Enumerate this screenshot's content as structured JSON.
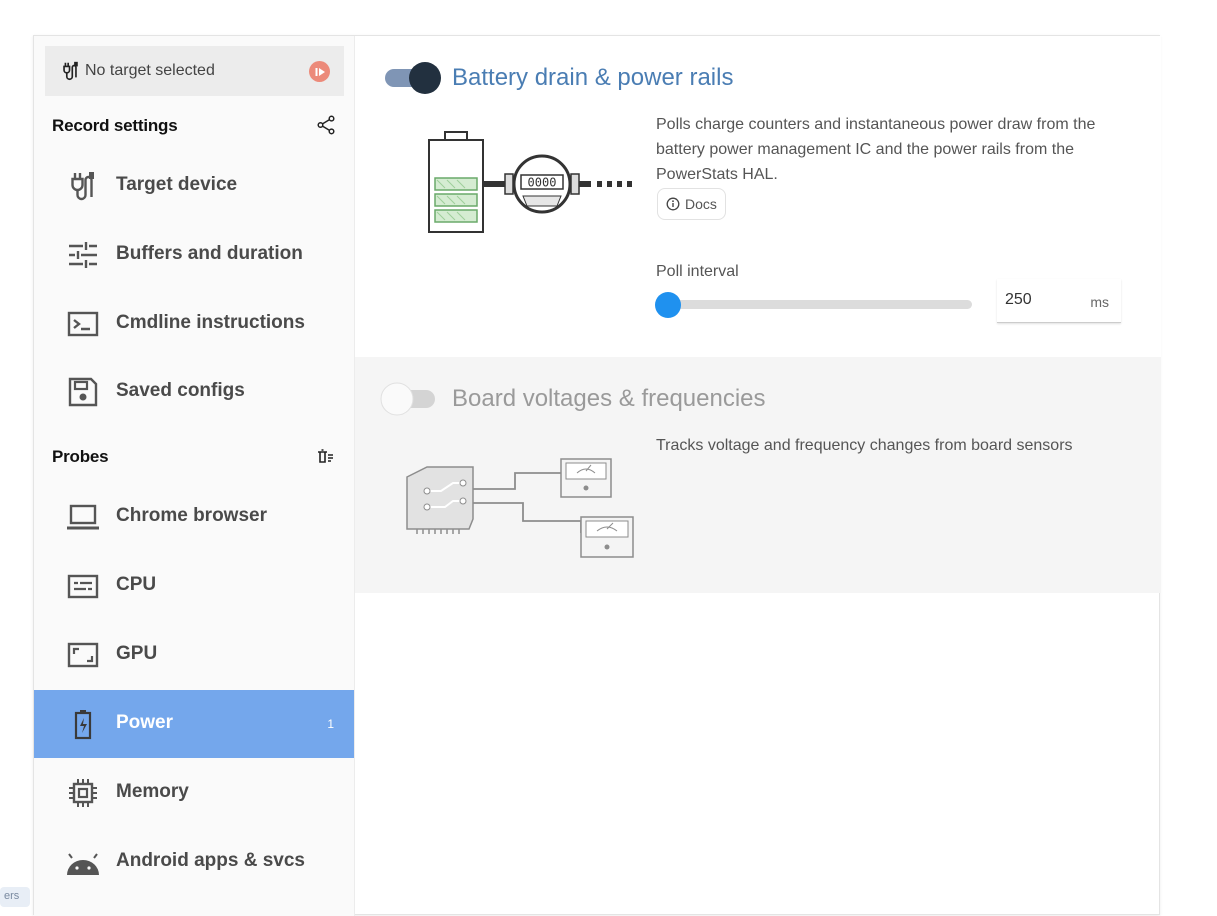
{
  "target": {
    "label": "No target selected"
  },
  "record_settings": {
    "heading": "Record settings",
    "items": [
      {
        "label": "Target device",
        "icon": "cable-icon"
      },
      {
        "label": "Buffers and duration",
        "icon": "tune-icon"
      },
      {
        "label": "Cmdline instructions",
        "icon": "terminal-icon"
      },
      {
        "label": "Saved configs",
        "icon": "save-icon"
      }
    ]
  },
  "probes": {
    "heading": "Probes",
    "items": [
      {
        "label": "Chrome browser",
        "icon": "laptop-icon"
      },
      {
        "label": "CPU",
        "icon": "cpu-list-icon"
      },
      {
        "label": "GPU",
        "icon": "gpu-icon"
      },
      {
        "label": "Power",
        "icon": "battery-charging-icon",
        "count": "1",
        "active": true
      },
      {
        "label": "Memory",
        "icon": "chip-icon"
      },
      {
        "label": "Android apps & svcs",
        "icon": "android-icon"
      }
    ]
  },
  "power_probes": [
    {
      "title": "Battery drain & power rails",
      "enabled": true,
      "description": "Polls charge counters and instantaneous power draw from the battery power management IC and the power rails from the PowerStats HAL.",
      "docs_label": "Docs",
      "meter_digits": "0000",
      "poll_interval": {
        "label": "Poll interval",
        "value": "250",
        "unit": "ms",
        "level": 0.0
      }
    },
    {
      "title": "Board voltages & frequencies",
      "enabled": false,
      "description": "Tracks voltage and frequency changes from board sensors"
    }
  ],
  "tooltip_fragment": "ers",
  "colors": {
    "accent_blue": "#4a7db3",
    "active_nav": "#74a7ec",
    "slider_blue": "#1f91ef",
    "record_red": "#ec8a7a"
  }
}
